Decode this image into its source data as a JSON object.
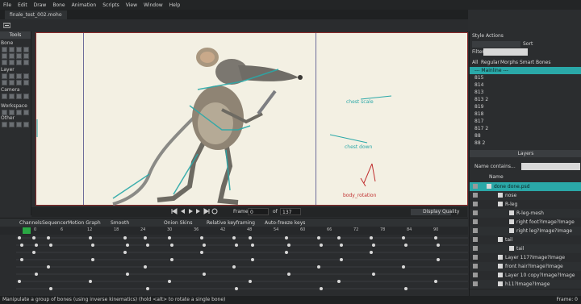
{
  "menu": [
    "File",
    "Edit",
    "Draw",
    "Bone",
    "Animation",
    "Scripts",
    "View",
    "Window",
    "Help"
  ],
  "document_tab": "finale_test_002.moho",
  "tools": {
    "title": "Tools",
    "sections": [
      "Bone",
      "Layer",
      "Camera",
      "Other"
    ]
  },
  "canvas": {
    "labels": {
      "chest_scale": "chest scale",
      "chest_down": "chest down",
      "body_rotation": "body_rotation"
    },
    "accent_label": "#2aa8a8",
    "accent_red": "#c03030"
  },
  "canvas_bar": {
    "frame_label": "Frame",
    "frame_value": "0",
    "of_label": "of",
    "total_frames": "137",
    "quality_label": "Display Quality"
  },
  "timeline": {
    "tabs": [
      "Channels",
      "Sequencer",
      "Motion Graph"
    ],
    "smooth": "Smooth",
    "onion": "Onion Skins",
    "relative": "Relative keyframing",
    "autofreeze": "Auto-freeze keys",
    "ruler": [
      "0",
      "6",
      "12",
      "18",
      "24",
      "30",
      "36",
      "42",
      "48",
      "54",
      "60",
      "66",
      "72",
      "78",
      "84",
      "90"
    ]
  },
  "right_panel": {
    "tabs": [
      "Style",
      "Actions"
    ],
    "sort": "Sort",
    "filter_label": "Filter:",
    "subtabs": [
      "All",
      "Regular",
      "Morphs",
      "Smart Bones"
    ],
    "actions": [
      "--- Mainline ---",
      "815",
      "814",
      "813",
      "813 2",
      "819",
      "818",
      "817",
      "817 2",
      "88",
      "88 2"
    ],
    "layers_title": "Layers",
    "name_filter": "Name contains...",
    "name_header": "Name",
    "layers": [
      {
        "name": "done done.psd",
        "selected": true,
        "indent": 30
      },
      {
        "name": "nose",
        "selected": false,
        "indent": 44
      },
      {
        "name": "R-leg",
        "selected": false,
        "indent": 44
      },
      {
        "name": "R-leg-mesh",
        "selected": false,
        "indent": 58
      },
      {
        "name": "right foot?Image?Image",
        "selected": false,
        "indent": 58
      },
      {
        "name": "right leg?Image?Image",
        "selected": false,
        "indent": 58
      },
      {
        "name": "tail",
        "selected": false,
        "indent": 44
      },
      {
        "name": "tail",
        "selected": false,
        "indent": 58
      },
      {
        "name": "Layer 117?Image?Image",
        "selected": false,
        "indent": 44
      },
      {
        "name": "front hair?Image?Image",
        "selected": false,
        "indent": 44
      },
      {
        "name": "Layer 10 copy?Image?Image",
        "selected": false,
        "indent": 44
      },
      {
        "name": "h11?Image?Image",
        "selected": false,
        "indent": 44
      }
    ]
  },
  "status": {
    "message": "Manipulate a group of bones (using inverse kinematics) (hold <alt> to rotate a single bone)",
    "frame": "Frame: 0"
  }
}
